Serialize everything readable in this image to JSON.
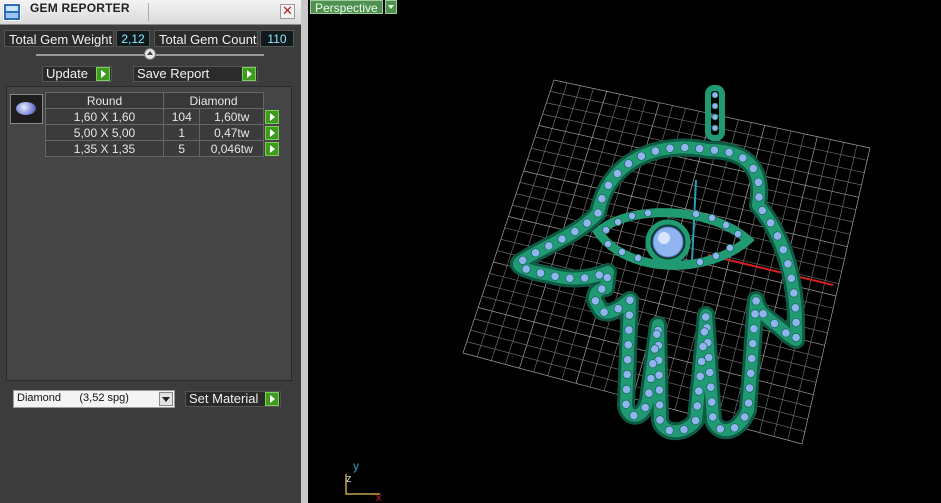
{
  "window": {
    "title": "GEM REPORTER",
    "close_glyph": "✕"
  },
  "summary": {
    "weight_label": "Total Gem Weight",
    "weight_value": "2,12",
    "count_label": "Total Gem Count",
    "count_value": "110"
  },
  "toolbar": {
    "update_label": "Update",
    "save_label": "Save Report"
  },
  "table": {
    "headers": [
      "Round",
      "Diamond"
    ],
    "rows": [
      {
        "size": "1,60 X 1,60",
        "count": "104",
        "weight": "1,60tw"
      },
      {
        "size": "5,00 X 5,00",
        "count": "1",
        "weight": "0,47tw"
      },
      {
        "size": "1,35 X 1,35",
        "count": "5",
        "weight": "0,046tw"
      }
    ]
  },
  "material": {
    "selected": "Diamond      (3,52 spg)",
    "set_label": "Set Material"
  },
  "viewport": {
    "view_label": "Perspective"
  },
  "axes": {
    "y": "y",
    "z": "z",
    "x": "x"
  },
  "icons": {
    "app": "gem-reporter-app-icon",
    "close": "close-icon",
    "go": "play-arrow-icon",
    "gem": "round-gem-icon",
    "dropdown": "chevron-down-icon"
  },
  "colors": {
    "panel_bg": "#3c3c3c",
    "value_text": "#8fe8ff",
    "go_button": "#3f9a1f",
    "perspective_tab": "#4f8f4f",
    "model_metal": "#1f9a72",
    "model_gem": "#8fb4f0",
    "grid": "#8a8a8a"
  }
}
